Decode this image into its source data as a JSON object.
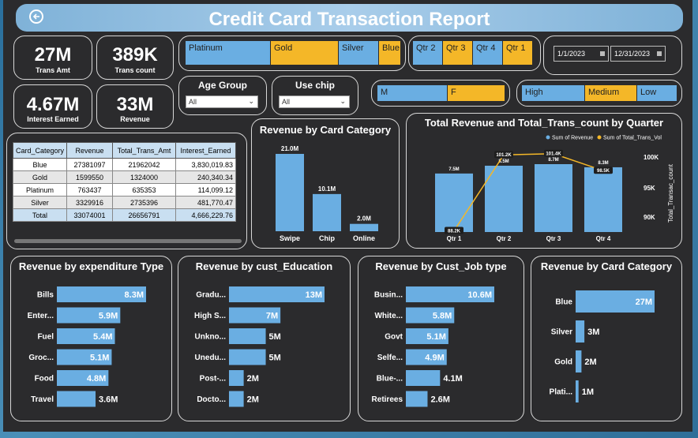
{
  "report_title": "Credit Card Transaction Report",
  "kpis": [
    {
      "value": "27M",
      "label": "Trans Amt"
    },
    {
      "value": "389K",
      "label": "Trans count"
    },
    {
      "value": "4.67M",
      "label": "Interest Earned"
    },
    {
      "value": "33M",
      "label": "Revenue"
    }
  ],
  "card_slicer": [
    "Platinum",
    "Gold",
    "Silver",
    "Blue"
  ],
  "quarter_slicer": [
    "Qtr 2",
    "Qtr 3",
    "Qtr 4",
    "Qtr 1"
  ],
  "date_range": {
    "start": "1/1/2023",
    "end": "12/31/2023"
  },
  "age_group": {
    "label": "Age Group",
    "value": "All"
  },
  "use_chip": {
    "label": "Use chip",
    "value": "All"
  },
  "gender_slicer": [
    "M",
    "F"
  ],
  "level_slicer": [
    "High",
    "Medium",
    "Low"
  ],
  "table": {
    "headers": [
      "Card_Category",
      "Revenue",
      "Total_Trans_Amt",
      "Interest_Earned"
    ],
    "rows": [
      [
        "Blue",
        "27381097",
        "21962042",
        "3,830,019.83"
      ],
      [
        "Gold",
        "1599550",
        "1324000",
        "240,340.34"
      ],
      [
        "Platinum",
        "763437",
        "635353",
        "114,099.12"
      ],
      [
        "Silver",
        "3329916",
        "2735396",
        "481,770.47"
      ]
    ],
    "total": [
      "Total",
      "33074001",
      "26656791",
      "4,666,229.76"
    ]
  },
  "chart_data": [
    {
      "id": "use_chip",
      "type": "bar",
      "title": "Revenue by Card Category",
      "categories": [
        "Swipe",
        "Chip",
        "Online"
      ],
      "values": [
        21.0,
        10.1,
        2.0
      ],
      "labels": [
        "21.0M",
        "10.1M",
        "2.0M"
      ],
      "color": "#6aaee2"
    },
    {
      "id": "quarter",
      "type": "bar",
      "title": "Total Revenue and Total_Trans_count by Quarter",
      "categories": [
        "Qtr 1",
        "Qtr 2",
        "Qtr 3",
        "Qtr 4"
      ],
      "series": [
        {
          "name": "Sum of Revenue",
          "values": [
            7.5,
            8.5,
            8.7,
            8.3
          ],
          "labels": [
            "7.5M",
            "8.5M",
            "8.7M",
            "8.3M"
          ],
          "color": "#6aaee2"
        },
        {
          "name": "Sum of Total_Trans_Vol",
          "values": [
            88.2,
            101.2,
            101.4,
            98.5
          ],
          "labels": [
            "88.2K",
            "101.2K",
            "101.4K",
            "98.5K"
          ],
          "color": "#f4b728"
        }
      ],
      "y2label": "Total_Transac_count",
      "y2ticks": [
        "100K",
        "95K",
        "90K"
      ],
      "y2lim": [
        88,
        101.5
      ]
    },
    {
      "id": "expenditure",
      "type": "bar",
      "title": "Revenue by expenditure Type",
      "categories": [
        "Bills",
        "Enter...",
        "Fuel",
        "Groc...",
        "Food",
        "Travel"
      ],
      "values": [
        8.3,
        5.9,
        5.4,
        5.1,
        4.8,
        3.6
      ],
      "labels": [
        "8.3M",
        "5.9M",
        "5.4M",
        "5.1M",
        "4.8M",
        "3.6M"
      ],
      "color": "#6aaee2"
    },
    {
      "id": "education",
      "type": "bar",
      "title": "Revenue by cust_Education",
      "categories": [
        "Gradu...",
        "High S...",
        "Unkno...",
        "Unedu...",
        "Post-...",
        "Docto..."
      ],
      "values": [
        13,
        7,
        5,
        5,
        2,
        2
      ],
      "labels": [
        "13M",
        "7M",
        "5M",
        "5M",
        "2M",
        "2M"
      ],
      "color": "#6aaee2"
    },
    {
      "id": "job",
      "type": "bar",
      "title": "Revenue by Cust_Job type",
      "categories": [
        "Busin...",
        "White...",
        "Govt",
        "Selfe...",
        "Blue-...",
        "Retirees"
      ],
      "values": [
        10.6,
        5.8,
        5.1,
        4.9,
        4.1,
        2.6
      ],
      "labels": [
        "10.6M",
        "5.8M",
        "5.1M",
        "4.9M",
        "4.1M",
        "2.6M"
      ],
      "color": "#6aaee2"
    },
    {
      "id": "card_cat",
      "type": "bar",
      "title": "Revenue by Card Category",
      "categories": [
        "Blue",
        "Silver",
        "Gold",
        "Plati..."
      ],
      "values": [
        27,
        3,
        2,
        1
      ],
      "labels": [
        "27M",
        "3M",
        "2M",
        "1M"
      ],
      "color": "#6aaee2"
    }
  ]
}
